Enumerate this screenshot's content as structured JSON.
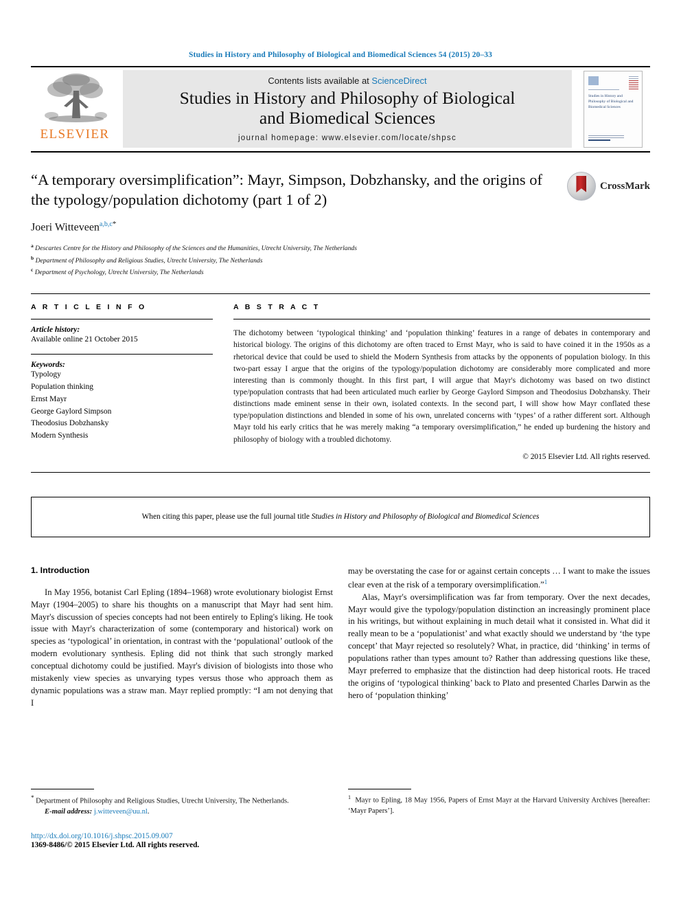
{
  "running_head": "Studies in History and Philosophy of Biological and Biomedical Sciences 54 (2015) 20–33",
  "masthead": {
    "publisher_logo_text": "ELSEVIER",
    "contents_prefix": "Contents lists available at ",
    "contents_link": "ScienceDirect",
    "journal_title": "Studies in History and Philosophy of Biological and Biomedical Sciences",
    "homepage": "journal homepage: www.elsevier.com/locate/shpsc",
    "cover_title": "Studies in History and Philosophy of Biological and Biomedical Sciences"
  },
  "article": {
    "title": "“A temporary oversimplification”: Mayr, Simpson, Dobzhansky, and the origins of the typology/population dichotomy (part 1 of 2)",
    "author": "Joeri Witteveen",
    "author_sups": "a,b,c",
    "author_star": "*",
    "crossmark_label": "CrossMark",
    "affiliations": [
      {
        "marker": "a",
        "text": "Descartes Centre for the History and Philosophy of the Sciences and the Humanities, Utrecht University, The Netherlands"
      },
      {
        "marker": "b",
        "text": "Department of Philosophy and Religious Studies, Utrecht University, The Netherlands"
      },
      {
        "marker": "c",
        "text": "Department of Psychology, Utrecht University, The Netherlands"
      }
    ]
  },
  "article_info": {
    "heading": "A R T I C L E    I N F O",
    "history_label": "Article history:",
    "history_value": "Available online 21 October 2015",
    "keywords_label": "Keywords:",
    "keywords": [
      "Typology",
      "Population thinking",
      "Ernst Mayr",
      "George Gaylord Simpson",
      "Theodosius Dobzhansky",
      "Modern Synthesis"
    ]
  },
  "abstract": {
    "heading": "A B S T R A C T",
    "text": "The dichotomy between ‘typological thinking’ and ‘population thinking’ features in a range of debates in contemporary and historical biology. The origins of this dichotomy are often traced to Ernst Mayr, who is said to have coined it in the 1950s as a rhetorical device that could be used to shield the Modern Synthesis from attacks by the opponents of population biology. In this two-part essay I argue that the origins of the typology/population dichotomy are considerably more complicated and more interesting than is commonly thought. In this first part, I will argue that Mayr's dichotomy was based on two distinct type/population contrasts that had been articulated much earlier by George Gaylord Simpson and Theodosius Dobzhansky. Their distinctions made eminent sense in their own, isolated contexts. In the second part, I will show how Mayr conflated these type/population distinctions and blended in some of his own, unrelated concerns with ‘types’ of a rather different sort. Although Mayr told his early critics that he was merely making “a temporary oversimplification,” he ended up burdening the history and philosophy of biology with a troubled dichotomy.",
    "copyright": "© 2015 Elsevier Ltd. All rights reserved."
  },
  "citation_notice": {
    "prefix": "When citing this paper, please use the full journal title ",
    "journal": "Studies in History and Philosophy of Biological and Biomedical Sciences"
  },
  "body": {
    "section_title": "1. Introduction",
    "left_para_1": "In May 1956, botanist Carl Epling (1894–1968) wrote evolutionary biologist Ernst Mayr (1904–2005) to share his thoughts on a manuscript that Mayr had sent him. Mayr's discussion of species concepts had not been entirely to Epling's liking. He took issue with Mayr's characterization of some (contemporary and historical) work on species as ‘typological’ in orientation, in contrast with the ‘populational’ outlook of the modern evolutionary synthesis. Epling did not think that such strongly marked conceptual dichotomy could be justified. Mayr's division of biologists into those who mistakenly view species as unvarying types versus those who approach them as dynamic populations was a straw man. Mayr replied promptly: “I am not denying that I",
    "right_para_1": "may be overstating the case for or against certain concepts … I want to make the issues clear even at the risk of a temporary oversimplification.”",
    "right_para_1_ref": "1",
    "right_para_2": "Alas, Mayr's oversimplification was far from temporary. Over the next decades, Mayr would give the typology/population distinction an increasingly prominent place in his writings, but without explaining in much detail what it consisted in. What did it really mean to be a ‘populationist’ and what exactly should we understand by ‘the type concept’ that Mayr rejected so resolutely? What, in practice, did ‘thinking’ in terms of populations rather than types amount to? Rather than addressing questions like these, Mayr preferred to emphasize that the distinction had deep historical roots. He traced the origins of ‘typological thinking’ back to Plato and presented Charles Darwin as the hero of ‘population thinking’"
  },
  "footnotes": {
    "corresponding_marker": "*",
    "corresponding": "Department of Philosophy and Religious Studies, Utrecht University, The Netherlands.",
    "email_label": "E-mail address:",
    "email": "j.witteveen@uu.nl",
    "doi": "http://dx.doi.org/10.1016/j.shpsc.2015.09.007",
    "issn_line": "1369-8486/© 2015 Elsevier Ltd. All rights reserved.",
    "note_1_marker": "1",
    "note_1": "Mayr to Epling, 18 May 1956, Papers of Ernst Mayr at the Harvard University Archives [hereafter: ‘Mayr Papers’]."
  }
}
